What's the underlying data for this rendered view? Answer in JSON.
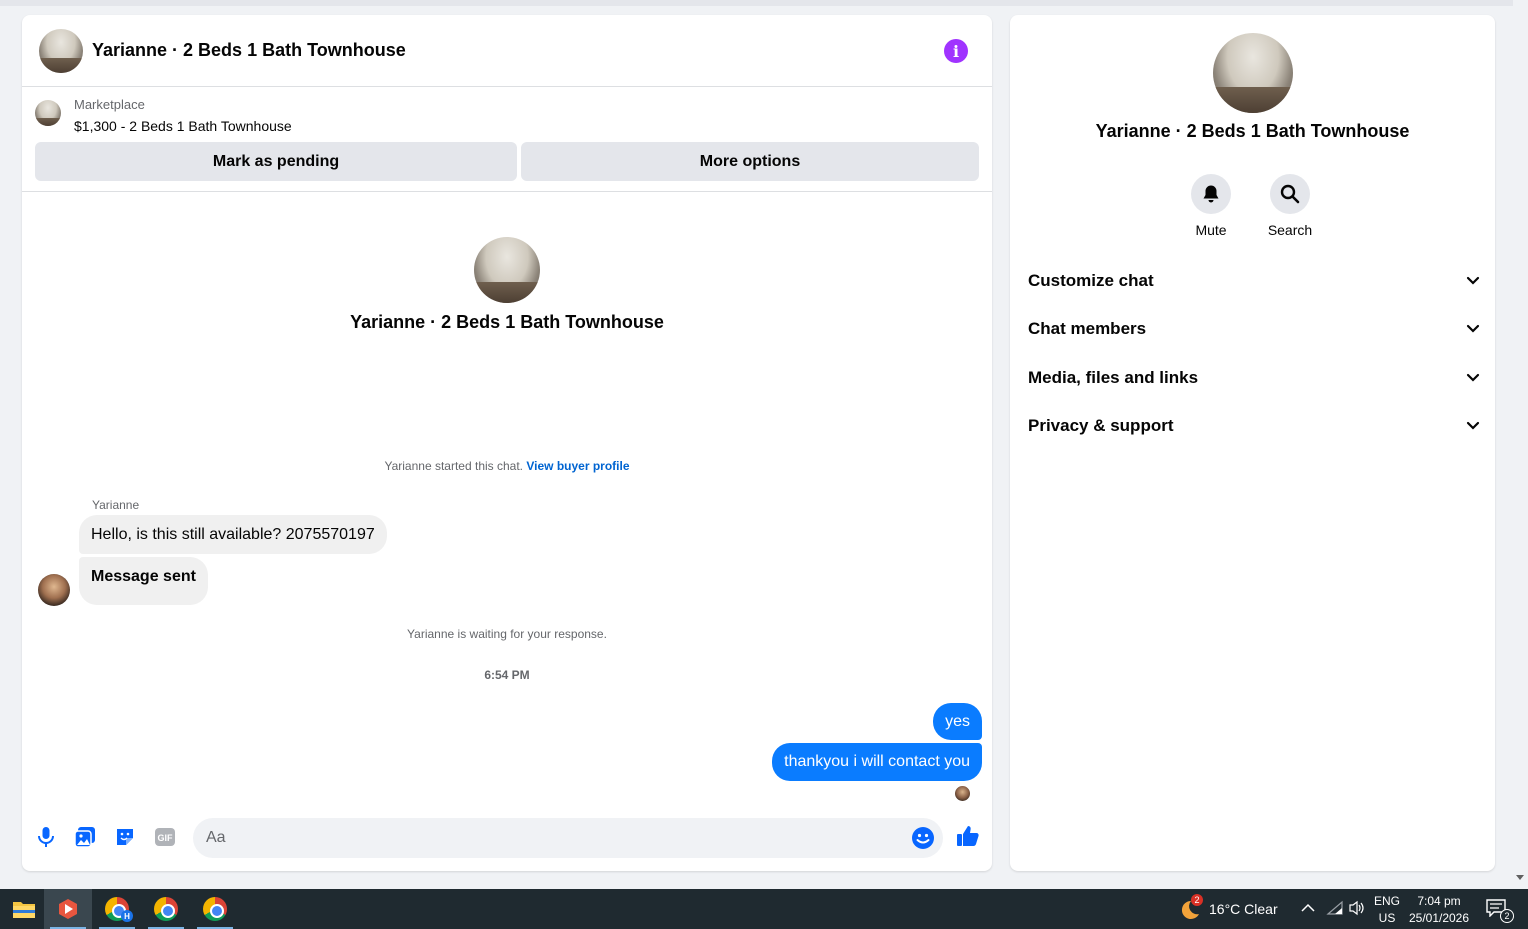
{
  "chat": {
    "title": "Yarianne · 2 Beds 1 Bath Townhouse",
    "info_icon": "info-icon"
  },
  "marketplace": {
    "label": "Marketplace",
    "listing": "$1,300 - 2 Beds 1 Bath Townhouse",
    "pending_button": "Mark as pending",
    "more_button": "More options"
  },
  "thread": {
    "name": "Yarianne · 2 Beds 1 Bath Townhouse",
    "started_text": "Yarianne started this chat.",
    "view_profile_link": "View buyer profile",
    "sender_name": "Yarianne",
    "incoming": [
      "Hello, is this still available? 2075570197",
      "Message sent"
    ],
    "waiting_text": "Yarianne is waiting for your response.",
    "timestamp": "6:54 PM",
    "outgoing": [
      "yes",
      "thankyou i will contact you"
    ]
  },
  "composer": {
    "placeholder": "Aa",
    "value": "",
    "icons": [
      "microphone-icon",
      "photo-icon",
      "sticker-icon",
      "gif-icon",
      "emoji-icon",
      "thumbs-up-icon"
    ],
    "gif_label": "GIF"
  },
  "sidebar": {
    "name": "Yarianne · 2 Beds 1 Bath Townhouse",
    "actions": [
      {
        "label": "Mute",
        "icon": "bell-icon"
      },
      {
        "label": "Search",
        "icon": "search-icon"
      }
    ],
    "sections": [
      "Customize chat",
      "Chat members",
      "Media, files and links",
      "Privacy & support"
    ]
  },
  "taskbar": {
    "weather_badge": "2",
    "weather": "16°C  Clear",
    "lang": "ENG",
    "region": "US",
    "time": "7:04 pm",
    "date": "25/01/2026",
    "notification_count": "2",
    "chrome_badge": "H"
  },
  "colors": {
    "accent_blue": "#0a7cff",
    "info_purple": "#a033ff",
    "link_blue": "#0064d1"
  }
}
